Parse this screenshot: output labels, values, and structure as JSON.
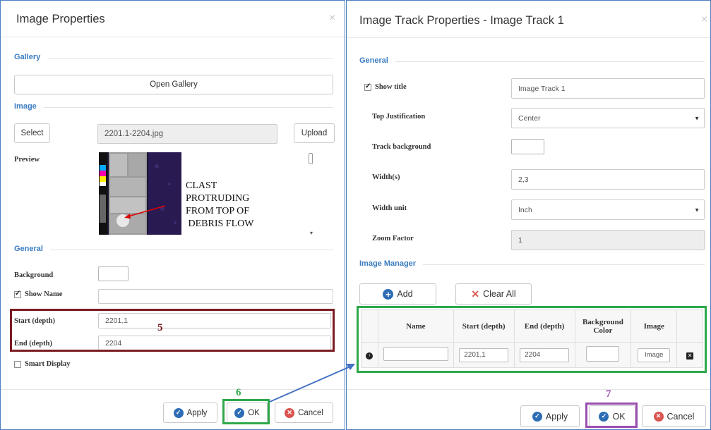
{
  "left_dialog": {
    "title": "Image Properties",
    "close": "×",
    "gallery_section": "Gallery",
    "open_gallery_label": "Open Gallery",
    "image_section": "Image",
    "select_label": "Select",
    "image_filename": "2201.1-2204.jpg",
    "upload_label": "Upload",
    "preview_label": "Preview",
    "preview_note": [
      "CLAST",
      "PROTRUDING",
      "FROM TOP OF",
      " DEBRIS FLOW"
    ],
    "general_section": "General",
    "background_label": "Background",
    "show_name_label": "Show Name",
    "show_name_checked": true,
    "start_depth_label": "Start (depth)",
    "start_depth_value": "2201,1",
    "end_depth_label": "End (depth)",
    "end_depth_value": "2204",
    "smart_display_label": "Smart Display",
    "smart_display_checked": false,
    "apply_label": "Apply",
    "ok_label": "OK",
    "cancel_label": "Cancel"
  },
  "right_dialog": {
    "title": "Image Track Properties - Image Track 1",
    "close": "×",
    "general_section": "General",
    "show_title_label": "Show title",
    "show_title_checked": true,
    "show_title_value": "Image Track 1",
    "top_justification_label": "Top Justification",
    "top_justification_value": "Center",
    "track_background_label": "Track background",
    "widths_label": "Width(s)",
    "widths_value": "2,3",
    "width_unit_label": "Width unit",
    "width_unit_value": "Inch",
    "zoom_factor_label": "Zoom Factor",
    "zoom_factor_value": "1",
    "image_manager_section": "Image Manager",
    "add_label": "Add",
    "clear_all_label": "Clear All",
    "table": {
      "headers": [
        "Name",
        "Start (depth)",
        "End (depth)",
        "Background Color",
        "Image"
      ],
      "row": {
        "name": "",
        "start": "2201,1",
        "end": "2204",
        "image_button": "Image"
      }
    },
    "apply_label": "Apply",
    "ok_label": "OK",
    "cancel_label": "Cancel"
  },
  "annotations": {
    "label_5": "5",
    "label_6": "6",
    "label_7": "7",
    "color_5": "#7b1b22",
    "color_6": "#2ea84a",
    "color_7": "#9b4fb0",
    "arrow_color": "#4472c4"
  },
  "colors": {
    "accent_blue": "#2d6db5",
    "section_blue": "#3b7cc0",
    "cancel_red": "#d9534f",
    "dialog_border": "#4a7fc1"
  },
  "icons": {
    "apply": "check-circle-icon",
    "ok": "check-circle-icon",
    "cancel": "x-circle-icon",
    "add": "plus-circle-icon",
    "clear_all": "x-mark-icon",
    "row_expand": "chevron-right-circle-icon",
    "row_delete": "delete-square-icon",
    "dropdown": "caret-down-icon"
  }
}
